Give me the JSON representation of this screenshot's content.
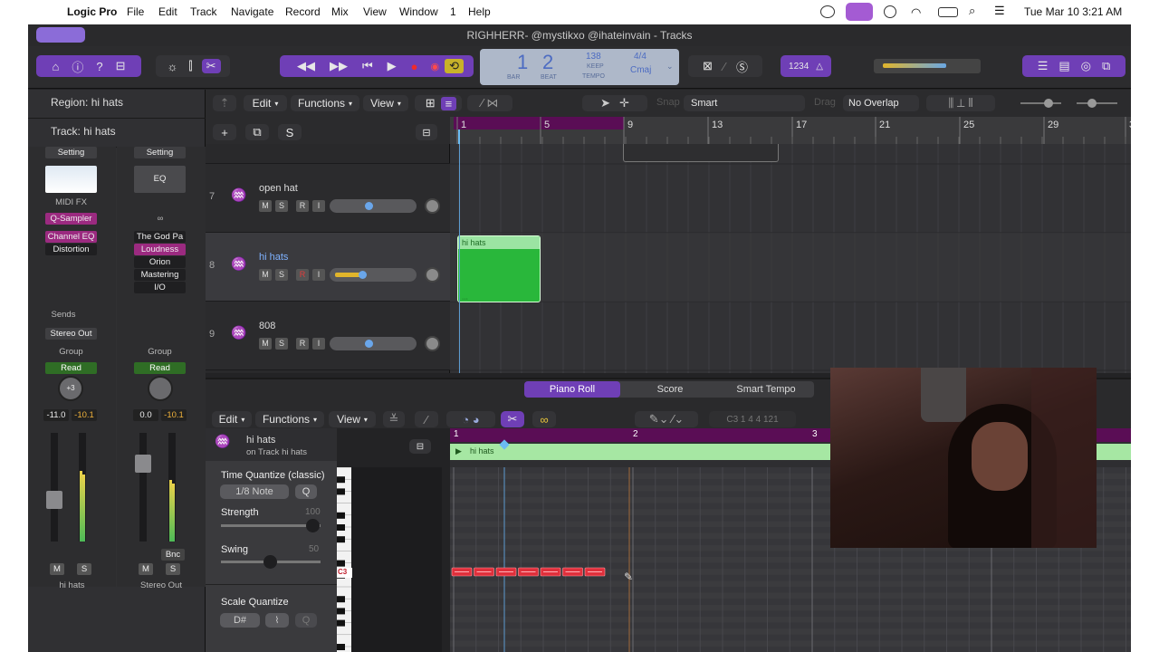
{
  "menubar": {
    "app": "Logic Pro",
    "items": [
      "File",
      "Edit",
      "Track",
      "Navigate",
      "Record",
      "Mix",
      "View",
      "Window",
      "1",
      "Help"
    ],
    "clock": "Tue Mar 10  3:21 AM"
  },
  "window": {
    "title": "RIGHHERR- @mystikxo @ihateinvain - Tracks"
  },
  "lcd": {
    "bar": "1",
    "beat": "2",
    "bar_label": "BAR",
    "beat_label": "BEAT",
    "tempo": "138",
    "tempo_mode": "KEEP",
    "tempo_label": "TEMPO",
    "signature": "4/4",
    "key": "Cmaj"
  },
  "toolbar": {
    "count_in": "1234"
  },
  "inspector": {
    "region_label": "Region: hi hats",
    "track_label": "Track:  hi hats",
    "strip1": {
      "setting": "Setting",
      "midi_fx": "MIDI FX",
      "instrument": "Q-Sampler",
      "plugins": [
        "Channel EQ",
        "Distortion"
      ],
      "sends": "Sends",
      "output": "Stereo Out",
      "group": "Group",
      "automation": "Read",
      "pan_value": "+3",
      "vol": "-11.0",
      "peak": "-10.1",
      "mute": "M",
      "solo": "S",
      "name": "hi hats"
    },
    "strip2": {
      "setting": "Setting",
      "eq": "EQ",
      "plugins": [
        "The God Pa",
        "Loudness",
        "Orion",
        "Mastering",
        "I/O"
      ],
      "group": "Group",
      "automation": "Read",
      "vol": "0.0",
      "peak": "-10.1",
      "bounce": "Bnc",
      "mute": "M",
      "solo": "S",
      "name": "Stereo Out"
    }
  },
  "tracks_menu": {
    "edit": "Edit",
    "functions": "Functions",
    "view": "View",
    "snap_label": "Snap",
    "snap": "Smart",
    "drag_label": "Drag",
    "drag": "No Overlap"
  },
  "ruler": {
    "bars": [
      "1",
      "5",
      "9",
      "13",
      "17",
      "21",
      "25",
      "29",
      "3"
    ]
  },
  "tracks": [
    {
      "num": "7",
      "name": "open hat",
      "m": "M",
      "s": "S",
      "r": "R",
      "i": "I"
    },
    {
      "num": "8",
      "name": "hi hats",
      "m": "M",
      "s": "S",
      "r": "R",
      "i": "I"
    },
    {
      "num": "9",
      "name": "808",
      "m": "M",
      "s": "S",
      "r": "R",
      "i": "I"
    }
  ],
  "region": {
    "name": "hi hats"
  },
  "piano_roll": {
    "tabs": [
      "Piano Roll",
      "Score",
      "Smart Tempo"
    ],
    "edit": "Edit",
    "functions": "Functions",
    "view": "View",
    "position": "C3   1 4 4 121",
    "track_name": "hi hats",
    "track_sub": "on Track hi hats",
    "time_quantize": "Time Quantize (classic)",
    "note_value": "1/8 Note",
    "q": "Q",
    "strength": "Strength",
    "strength_value": "100",
    "swing": "Swing",
    "swing_value": "50",
    "scale_quantize": "Scale Quantize",
    "scale_key": "D#",
    "key_label": "C3",
    "ruler": [
      "1",
      "2",
      "3"
    ],
    "region_name": "hi hats",
    "note_count": 7
  },
  "colors": {
    "accent": "#6f3fb6",
    "region": "#29b73b",
    "note": "#e0303c",
    "ruler_purple": "#5a0d55"
  }
}
